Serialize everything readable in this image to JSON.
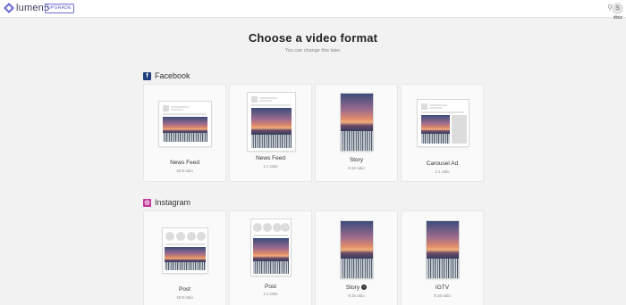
{
  "app": {
    "logo_text": "lumen5",
    "upgrade_label": "UPGRADE",
    "user_label": "dtsiz",
    "avatar_initial": "S"
  },
  "header": {
    "title": "Choose a video format",
    "subtitle": "You can change this later."
  },
  "sections": [
    {
      "name": "Facebook",
      "icon": "facebook-icon",
      "cards": [
        {
          "label": "News Feed",
          "ratio": "16:9 ratio"
        },
        {
          "label": "News Feed",
          "ratio": "1:1 ratio"
        },
        {
          "label": "Story",
          "ratio": "9:16 ratio"
        },
        {
          "label": "Carousel Ad",
          "ratio": "1:1 ratio"
        }
      ]
    },
    {
      "name": "Instagram",
      "icon": "instagram-icon",
      "cards": [
        {
          "label": "Post",
          "ratio": "16:9 ratio"
        },
        {
          "label": "Post",
          "ratio": "1:1 ratio"
        },
        {
          "label": "Story",
          "ratio": "9:16 ratio",
          "info_icon": "info-icon"
        },
        {
          "label": "IGTV",
          "ratio": "9:16 ratio"
        }
      ]
    }
  ],
  "colors": {
    "accent": "#5b5bc9",
    "facebook": "#1f3f7a",
    "instagram": "#c1359b"
  }
}
